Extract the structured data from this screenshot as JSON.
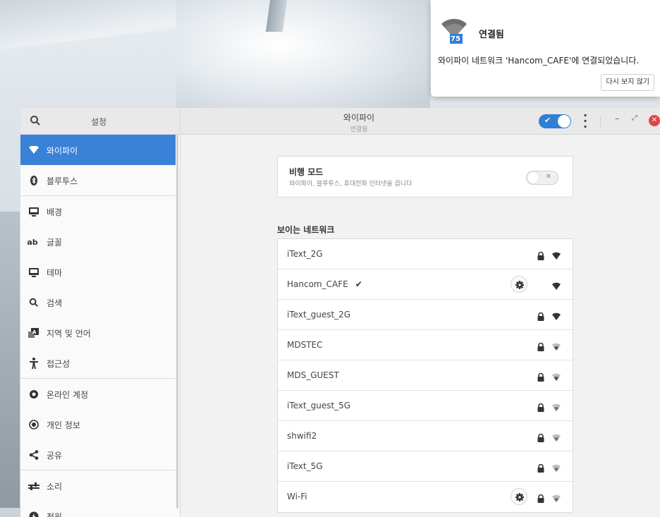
{
  "notification": {
    "title": "연결됨",
    "badge": "75",
    "body": "와이파이 네트워크 'Hancom_CAFE'에 연결되었습니다.",
    "dismiss_label": "다시 보지 않기"
  },
  "window": {
    "sidebar_title": "설정",
    "title": "와이파이",
    "subtitle": "연결됨",
    "wifi_enabled": true,
    "accent_color": "#3a82d8",
    "close_color": "#e0444a"
  },
  "sidebar": {
    "items": [
      {
        "label": "와이파이",
        "icon": "wifi-icon",
        "active": true
      },
      {
        "label": "블루투스",
        "icon": "bluetooth-icon"
      },
      {
        "label": "배경",
        "icon": "monitor-icon"
      },
      {
        "label": "글꼴",
        "icon": "font-icon",
        "glyph": "ab"
      },
      {
        "label": "테마",
        "icon": "monitor-icon"
      },
      {
        "label": "검색",
        "icon": "search-icon"
      },
      {
        "label": "지역 및 언어",
        "icon": "region-icon"
      },
      {
        "label": "접근성",
        "icon": "accessibility-icon"
      },
      {
        "label": "온라인 계정",
        "icon": "online-accounts-icon"
      },
      {
        "label": "개인 정보",
        "icon": "privacy-icon"
      },
      {
        "label": "공유",
        "icon": "share-icon"
      },
      {
        "label": "소리",
        "icon": "sound-icon"
      },
      {
        "label": "전원",
        "icon": "power-icon"
      }
    ]
  },
  "airplane_mode": {
    "title": "비행 모드",
    "description": "와이파이, 블루투스, 휴대전화 인터넷을 끕니다",
    "enabled": false
  },
  "networks_heading": "보이는 네트워크",
  "networks": [
    {
      "name": "iText_2G",
      "connected": false,
      "settings": false,
      "secured": true,
      "signal": "strong"
    },
    {
      "name": "Hancom_CAFE",
      "connected": true,
      "settings": true,
      "secured": false,
      "signal": "strong"
    },
    {
      "name": "iText_guest_2G",
      "connected": false,
      "settings": false,
      "secured": true,
      "signal": "strong"
    },
    {
      "name": "MDSTEC",
      "connected": false,
      "settings": false,
      "secured": true,
      "signal": "medium"
    },
    {
      "name": "MDS_GUEST",
      "connected": false,
      "settings": false,
      "secured": true,
      "signal": "medium"
    },
    {
      "name": "iText_guest_5G",
      "connected": false,
      "settings": false,
      "secured": true,
      "signal": "weak"
    },
    {
      "name": "shwifi2",
      "connected": false,
      "settings": false,
      "secured": true,
      "signal": "weak"
    },
    {
      "name": "iText_5G",
      "connected": false,
      "settings": false,
      "secured": true,
      "signal": "weak"
    },
    {
      "name": "Wi-Fi",
      "connected": false,
      "settings": true,
      "secured": true,
      "signal": "weak"
    }
  ]
}
